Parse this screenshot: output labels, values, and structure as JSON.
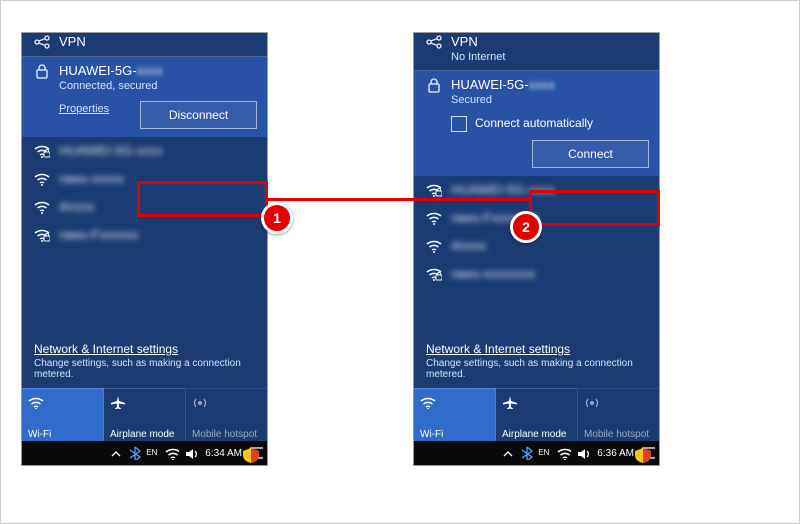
{
  "annotations": {
    "step1": "1",
    "step2": "2"
  },
  "left": {
    "vpn": {
      "title": "VPN",
      "status": ""
    },
    "selected": {
      "name": "HUAWEI-5G-",
      "status": "Connected, secured",
      "properties": "Properties"
    },
    "button": "Disconnect",
    "networks": [
      {
        "name": "HUAWEI-5G-",
        "blur": "xxxx"
      },
      {
        "name": "rawu-",
        "blur": "xxxxx"
      },
      {
        "name": "An",
        "blur": "xxx"
      },
      {
        "name": "rawu-F",
        "blur": "xxxxxx"
      }
    ],
    "settings": {
      "title": "Network & Internet settings",
      "desc": "Change settings, such as making a connection metered."
    },
    "tiles": {
      "wifi": "Wi-Fi",
      "airplane": "Airplane mode",
      "hotspot": "Mobile hotspot"
    },
    "taskbar": {
      "time": "6:34 AM"
    }
  },
  "right": {
    "vpn": {
      "title": "VPN",
      "status": "No Internet"
    },
    "selected": {
      "name": "HUAWEI-5G-",
      "status": "Secured",
      "checkbox": "Connect automatically"
    },
    "button": "Connect",
    "networks": [
      {
        "name": "HUAWEI-5G-",
        "blur": "xxxx"
      },
      {
        "name": "rawu-F",
        "blur": "xxxxx er"
      },
      {
        "name": "An",
        "blur": "xxx"
      },
      {
        "name": "rawu-",
        "blur": "xxxxxxxx"
      }
    ],
    "settings": {
      "title": "Network & Internet settings",
      "desc": "Change settings, such as making a connection metered."
    },
    "tiles": {
      "wifi": "Wi-Fi",
      "airplane": "Airplane mode",
      "hotspot": "Mobile hotspot"
    },
    "taskbar": {
      "time": "6:36 AM"
    }
  }
}
